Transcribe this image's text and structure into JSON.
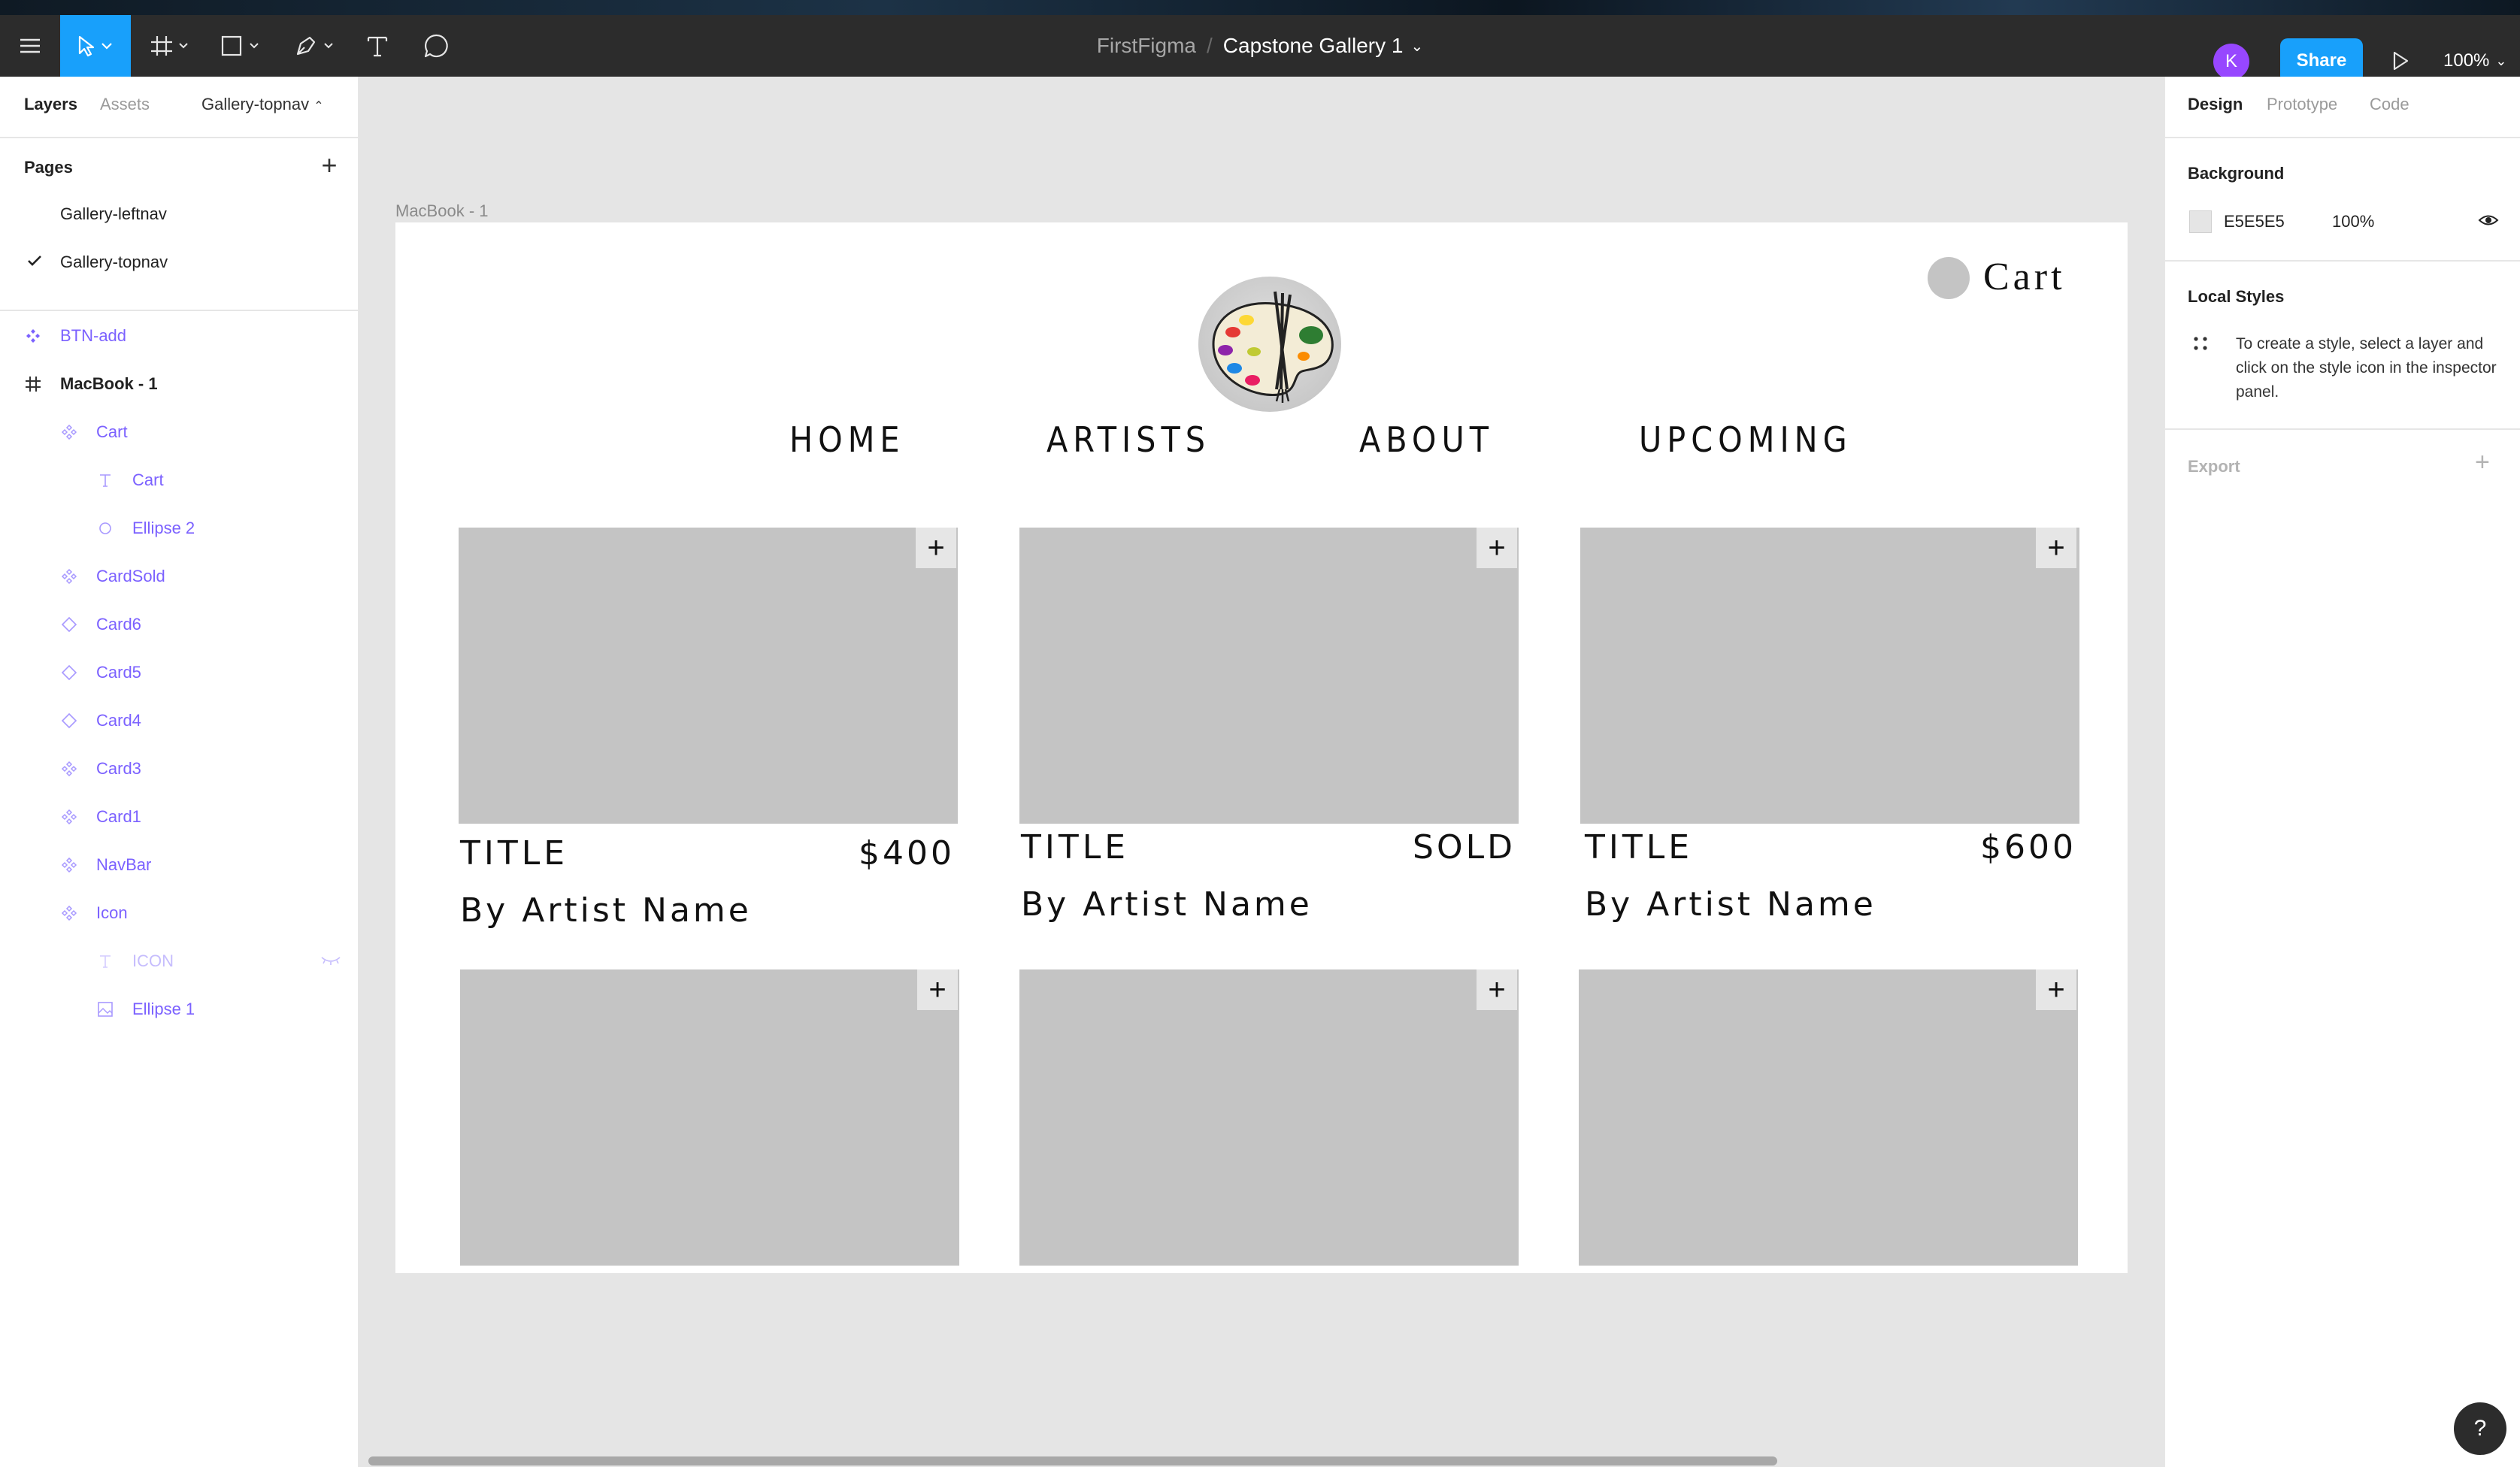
{
  "toolbar": {
    "project_name": "FirstFigma",
    "separator": "/",
    "file_name": "Capstone Gallery 1",
    "avatar_initial": "K",
    "share_label": "Share",
    "zoom": "100%"
  },
  "left_panel": {
    "tabs": [
      "Layers",
      "Assets"
    ],
    "current_page_dropdown": "Gallery-topnav",
    "pages_title": "Pages",
    "pages": [
      {
        "name": "Gallery-leftnav",
        "selected": false
      },
      {
        "name": "Gallery-topnav",
        "selected": true
      }
    ],
    "layers": [
      {
        "name": "BTN-add",
        "icon": "component-icon"
      },
      {
        "name": "MacBook - 1",
        "icon": "frame-icon"
      },
      {
        "name": "Cart",
        "icon": "instance-icon"
      },
      {
        "name": "Cart",
        "icon": "text-icon"
      },
      {
        "name": "Ellipse 2",
        "icon": "ellipse-icon"
      },
      {
        "name": "CardSold",
        "icon": "instance-icon"
      },
      {
        "name": "Card6",
        "icon": "instance-diamond-icon"
      },
      {
        "name": "Card5",
        "icon": "instance-diamond-icon"
      },
      {
        "name": "Card4",
        "icon": "instance-diamond-icon"
      },
      {
        "name": "Card3",
        "icon": "instance-icon"
      },
      {
        "name": "Card1",
        "icon": "instance-icon"
      },
      {
        "name": "NavBar",
        "icon": "instance-icon"
      },
      {
        "name": "Icon",
        "icon": "instance-icon"
      },
      {
        "name": "ICON",
        "icon": "text-icon",
        "hidden": true
      },
      {
        "name": "Ellipse 1",
        "icon": "image-icon"
      }
    ]
  },
  "right_panel": {
    "tabs": [
      "Design",
      "Prototype",
      "Code"
    ],
    "background_title": "Background",
    "background_hex": "E5E5E5",
    "background_opacity": "100%",
    "local_styles_title": "Local Styles",
    "local_styles_help": "To create a style, select a layer and click on the style icon in the inspector panel.",
    "export_title": "Export",
    "help_label": "?"
  },
  "canvas": {
    "frame_label": "MacBook - 1",
    "cart_label": "Cart",
    "nav": [
      "HOME",
      "ARTISTS",
      "ABOUT",
      "UPCOMING"
    ],
    "cards": [
      {
        "title": "TITLE",
        "price": "$400",
        "artist": "By Artist Name"
      },
      {
        "title": "TITLE",
        "price": "SOLD",
        "artist": "By Artist Name"
      },
      {
        "title": "TITLE",
        "price": "$600",
        "artist": "By Artist Name"
      }
    ],
    "add_label": "+"
  },
  "colors": {
    "accent": "#18a0fb",
    "component_purple": "#7b61ff",
    "toolbar_bg": "#2c2c2c",
    "canvas_bg": "#e5e5e5",
    "card_placeholder": "#c4c4c4"
  }
}
